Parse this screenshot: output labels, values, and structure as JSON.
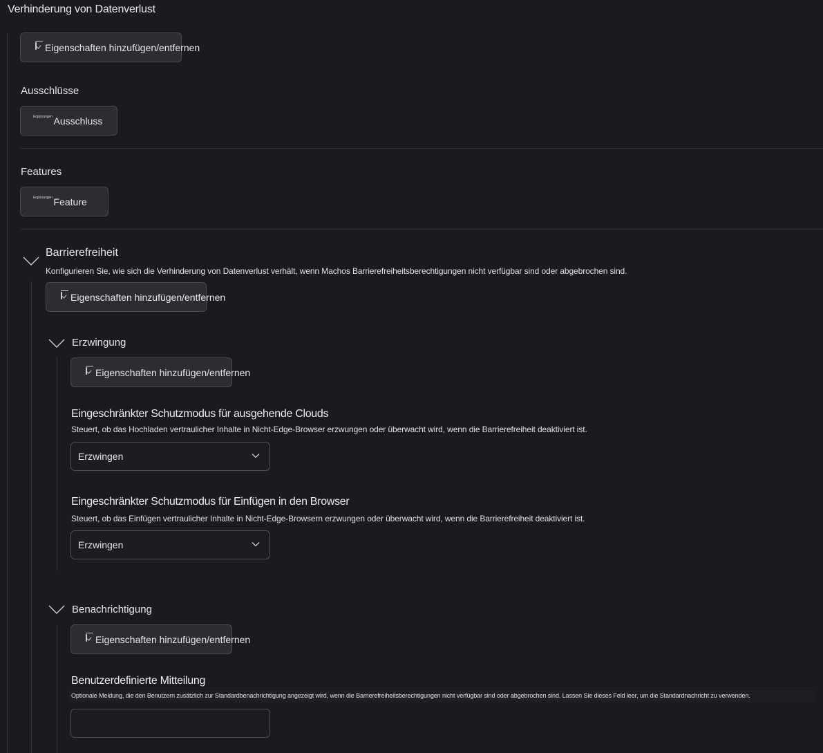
{
  "page": {
    "title": "Verhinderung von Datenverlust"
  },
  "buttons": {
    "add_remove_label": "Eigenschaften hinzufügen/entfernen",
    "addition_tag": "Ergänzungen",
    "exclusion_label": "Ausschluss",
    "feature_label": "Feature"
  },
  "sections": {
    "exclusions_label": "Ausschlüsse",
    "features_label": "Features"
  },
  "accessibility": {
    "title": "Barrierefreiheit",
    "description": "Konfigurieren Sie, wie sich die Verhinderung von Datenverlust verhält, wenn Machos Barrierefreiheitsberechtigungen nicht verfügbar sind oder abgebrochen sind.",
    "enforcement": {
      "title": "Erzwingung",
      "cloud_egress": {
        "title": "Eingeschränkter Schutzmodus für ausgehende Clouds",
        "description": "Steuert, ob das Hochladen vertraulicher Inhalte in Nicht-Edge-Browser erzwungen oder überwacht wird, wenn die Barrierefreiheit deaktiviert ist.",
        "value": "Erzwingen"
      },
      "paste_to_browser": {
        "title": "Eingeschränkter Schutzmodus für Einfügen in den Browser",
        "description": "Steuert, ob das Einfügen vertraulicher Inhalte in Nicht-Edge-Browsern erzwungen oder überwacht wird, wenn die Barrierefreiheit deaktiviert ist.",
        "value": "Erzwingen"
      }
    },
    "notification": {
      "title": "Benachrichtigung",
      "custom_message": {
        "title": "Benutzerdefinierte Mitteilung",
        "description": "Optionale Meldung, die den Benutzern zusätzlich zur Standardbenachrichtigung angezeigt wird, wenn die Barrierefreiheitsberechtigungen nicht verfügbar sind oder abgebrochen sind. Lassen Sie dieses Feld leer, um die Standardnachricht zu verwenden.",
        "value": ""
      }
    }
  },
  "icons": {
    "add_remove": "checklist-icon",
    "collapse": "chevron-down-icon",
    "dropdown": "chevron-down-icon"
  }
}
